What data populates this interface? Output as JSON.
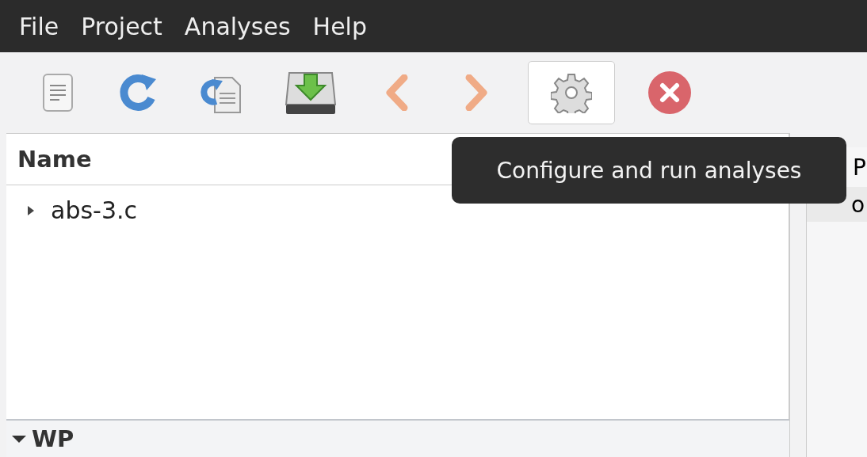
{
  "menu": [
    "File",
    "Project",
    "Analyses",
    "Help"
  ],
  "toolbar": [
    {
      "kind": "document",
      "hovered": false
    },
    {
      "kind": "refresh",
      "hovered": false
    },
    {
      "kind": "copy",
      "hovered": false
    },
    {
      "kind": "download",
      "hovered": false
    },
    {
      "kind": "back",
      "hovered": false
    },
    {
      "kind": "forward",
      "hovered": false
    },
    {
      "kind": "gear",
      "hovered": true
    },
    {
      "kind": "stop",
      "hovered": false
    }
  ],
  "tree": {
    "column": "Name",
    "rows": [
      {
        "label": "abs-3.c",
        "expanded": false
      }
    ]
  },
  "section": {
    "label": "WP",
    "expanded": true
  },
  "right_pane": {
    "header": "P",
    "row": "o"
  },
  "tooltip": "Configure and run analyses"
}
